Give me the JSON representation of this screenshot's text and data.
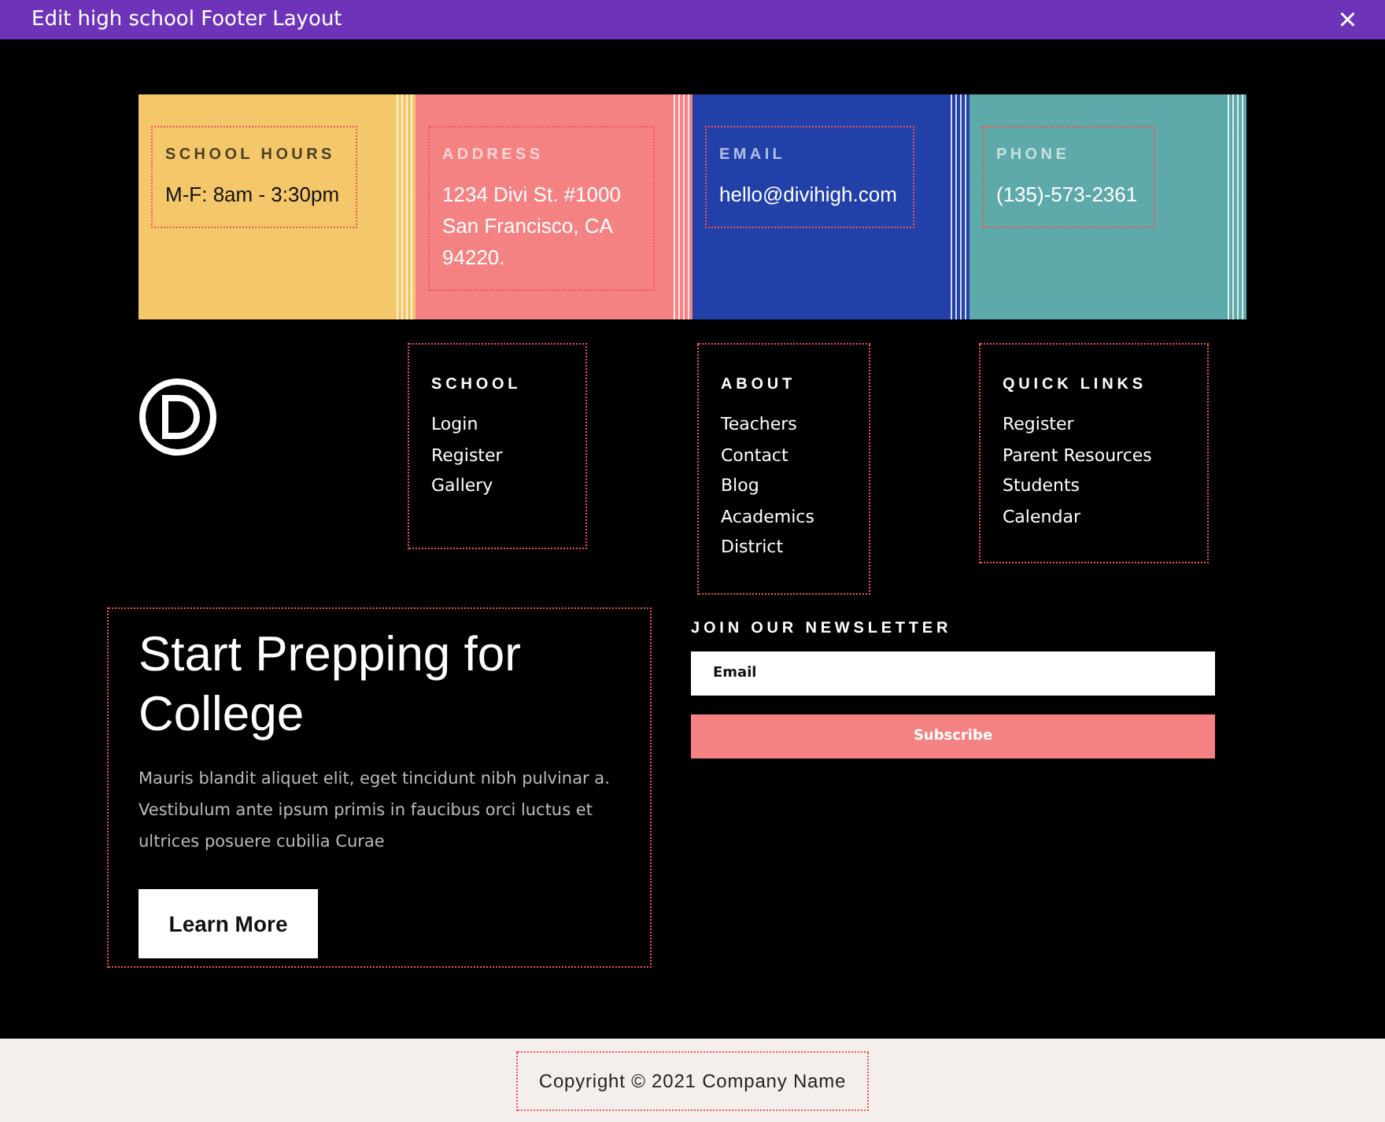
{
  "window": {
    "title": "Edit high school Footer Layout",
    "close": "×"
  },
  "contact_cards": [
    {
      "label": "SCHOOL HOURS",
      "lines": [
        "M-F: 8am - 3:30pm"
      ],
      "color": "#f5c76b"
    },
    {
      "label": "ADDRESS",
      "lines": [
        "1234 Divi St. #1000 San Francisco, CA 94220."
      ],
      "color": "#f58282"
    },
    {
      "label": "EMAIL",
      "lines": [
        "hello@divihigh.com"
      ],
      "color": "#2140a8"
    },
    {
      "label": "PHONE",
      "lines": [
        "(135)-573-2361"
      ],
      "color": "#5ea9a9"
    }
  ],
  "link_columns": [
    {
      "title": "SCHOOL",
      "links": [
        "Login",
        "Register",
        "Gallery"
      ]
    },
    {
      "title": "ABOUT",
      "links": [
        "Teachers",
        "Contact",
        "Blog",
        "Academics",
        "District"
      ]
    },
    {
      "title": "QUICK LINKS",
      "links": [
        "Register",
        "Parent Resources",
        "Students",
        "Calendar"
      ]
    }
  ],
  "promo": {
    "heading": "Start Prepping for College",
    "text": "Mauris blandit aliquet elit, eget tincidunt nibh pulvinar a. Vestibulum ante ipsum primis in faucibus orci luctus et ultrices posuere cubilia Curae",
    "button": "Learn More"
  },
  "newsletter": {
    "title": "JOIN OUR NEWSLETTER",
    "placeholder": "Email",
    "button": "Subscribe"
  },
  "copyright": "Copyright © 2021 Company Name"
}
